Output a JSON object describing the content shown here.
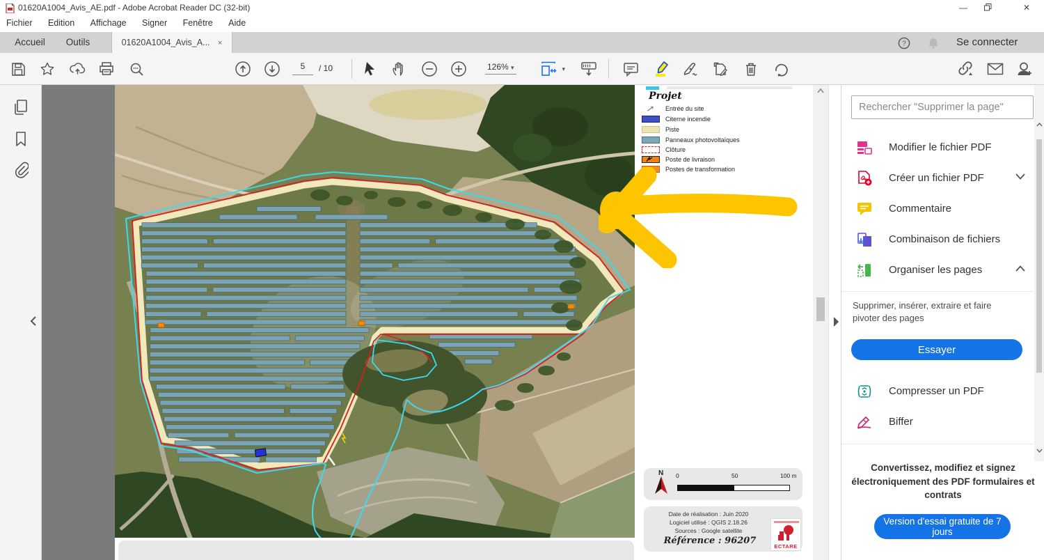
{
  "app": {
    "title": "01620A1004_Avis_AE.pdf - Adobe Acrobat Reader DC (32-bit)"
  },
  "menu": {
    "items": [
      "Fichier",
      "Edition",
      "Affichage",
      "Signer",
      "Fenêtre",
      "Aide"
    ]
  },
  "tabs": {
    "home": "Accueil",
    "tools": "Outils",
    "doc": "01620A1004_Avis_A...",
    "close": "×",
    "sign_in": "Se connecter"
  },
  "toolbar": {
    "page_current": "5",
    "page_total": "/ 10",
    "zoom_level": "126%"
  },
  "panel": {
    "search_placeholder": "Rechercher \"Supprimer la page\"",
    "items": [
      {
        "label": "Modifier le fichier PDF"
      },
      {
        "label": "Créer un fichier PDF"
      },
      {
        "label": "Commentaire"
      },
      {
        "label": "Combinaison de fichiers"
      },
      {
        "label": "Organiser les pages"
      }
    ],
    "organize_desc": "Supprimer, insérer, extraire et faire pivoter des pages",
    "try_button": "Essayer",
    "compress_label": "Compresser un PDF",
    "redact_label": "Biffer",
    "promo": "Convertissez, modifiez et signez électroniquement des PDF formulaires et contrats",
    "trial_button": "Version d'essai gratuite de 7 jours"
  },
  "document": {
    "legend": {
      "title": "Projet",
      "items": [
        {
          "label": "Entrée du site",
          "swatch": "entry-arrow-icon"
        },
        {
          "label": "Citerne incendie",
          "color": "#3c4fc9"
        },
        {
          "label": "Piste",
          "color": "#ece5b2"
        },
        {
          "label": "Panneaux photovoltaïques",
          "color": "#7da6b6"
        },
        {
          "label": "Clôture",
          "color": "#d42020"
        },
        {
          "label": "Poste de livraison",
          "color": "#f0830f"
        },
        {
          "label": "Postes de transformation",
          "color": "#f68c1f"
        }
      ]
    },
    "scalebar": {
      "north": "N",
      "tick0": "0",
      "tick50": "50",
      "tick100": "100 m"
    },
    "info": {
      "line1": "Date de réalisation : Juin 2020",
      "line2": "Logiciel utilisé : QGIS 2.18.26",
      "line3": "Sources : Google satellite",
      "reference": "Référence : 96207",
      "logo": "ECTARE"
    },
    "map_colors": {
      "panel_fill": "#7ca3b3",
      "panel_stroke": "#3f6374",
      "piste": "#f1e9bb",
      "fence": "#d42020",
      "boundary": "#3fd8f0",
      "highlight": "#fdc500"
    }
  }
}
